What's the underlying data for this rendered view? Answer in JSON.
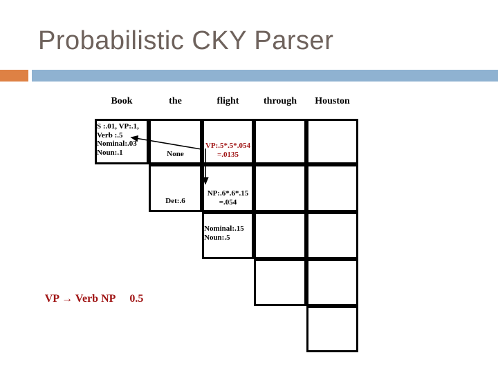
{
  "slide": {
    "title": "Probabilistic CKY Parser",
    "title_color": "#6E625C",
    "accent_square_color": "#DE8144",
    "accent_bar_color": "#8FB2D1"
  },
  "chart": {
    "type": "table",
    "column_headers": [
      "Book",
      "the",
      "flight",
      "through",
      "Houston"
    ],
    "cells": [
      {
        "row": 0,
        "col": 0,
        "text": "S :.01, VP:.1,\nVerb :.5\nNominal:.03\nNoun:.1",
        "align": "left",
        "color": "black"
      },
      {
        "row": 0,
        "col": 1,
        "text": "None",
        "align": "center",
        "color": "black"
      },
      {
        "row": 0,
        "col": 2,
        "text": "VP:.5*.5*.054\n=.0135",
        "align": "center",
        "color": "red"
      },
      {
        "row": 0,
        "col": 3,
        "text": "",
        "align": "center",
        "color": "black"
      },
      {
        "row": 0,
        "col": 4,
        "text": "",
        "align": "center",
        "color": "black"
      },
      {
        "row": 1,
        "col": 1,
        "text": "Det:.6",
        "align": "center",
        "color": "black"
      },
      {
        "row": 1,
        "col": 2,
        "text": "NP:.6*.6*.15\n=.054",
        "align": "center",
        "color": "black"
      },
      {
        "row": 1,
        "col": 3,
        "text": "",
        "align": "center",
        "color": "black"
      },
      {
        "row": 1,
        "col": 4,
        "text": "",
        "align": "center",
        "color": "black"
      },
      {
        "row": 2,
        "col": 2,
        "text": "Nominal:.15\nNoun:.5",
        "align": "left",
        "color": "black"
      },
      {
        "row": 2,
        "col": 3,
        "text": "",
        "align": "center",
        "color": "black"
      },
      {
        "row": 2,
        "col": 4,
        "text": "",
        "align": "center",
        "color": "black"
      },
      {
        "row": 3,
        "col": 3,
        "text": "",
        "align": "center",
        "color": "black"
      },
      {
        "row": 3,
        "col": 4,
        "text": "",
        "align": "center",
        "color": "black"
      },
      {
        "row": 4,
        "col": 4,
        "text": "",
        "align": "center",
        "color": "black"
      }
    ],
    "annotations": {
      "diagonal_arrow_target": "Verb :.5",
      "vertical_arrow_target": "NP:.6*.6*.15"
    }
  },
  "caption": {
    "rule": "VP → Verb NP",
    "probability": "0.5",
    "color": "#A01515"
  }
}
